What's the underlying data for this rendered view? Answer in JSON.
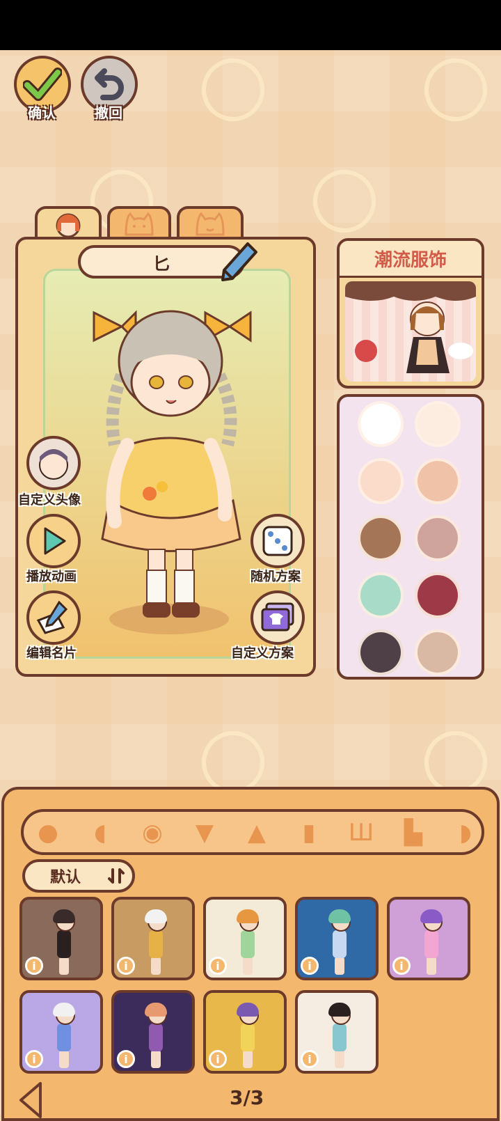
{
  "top_buttons": {
    "confirm_label": "确认",
    "undo_label": "撤回"
  },
  "tabs": [
    {
      "name": "face",
      "icon": "girl-face-icon"
    },
    {
      "name": "pet-cat",
      "icon": "cat-face-icon"
    },
    {
      "name": "pet-cat-2",
      "icon": "cat-smile-icon"
    }
  ],
  "character": {
    "name": "匕",
    "edit_icon": "pencil-icon"
  },
  "side_actions": {
    "custom_avatar": "自定义头像",
    "play_animation": "播放动画",
    "edit_card": "编辑名片",
    "random_plan": "随机方案",
    "custom_plan": "自定义方案"
  },
  "trend": {
    "title": "潮流服饰"
  },
  "palette": {
    "swatches": [
      "#ffffff",
      "#fdece0",
      "#fbdccb",
      "#f0c2a8",
      "#a57558",
      "#cfa49c",
      "#a8dcc8",
      "#9e3a48",
      "#4f3f46",
      "#d9b8a4"
    ]
  },
  "colors": {
    "outline": "#6b3a2a",
    "panel": "#f6d79b",
    "bottom_panel": "#f3b76d",
    "accent_red": "#d15c4a"
  },
  "categories": [
    {
      "name": "head",
      "icon": "head-icon"
    },
    {
      "name": "hair",
      "icon": "hair-icon"
    },
    {
      "name": "eye",
      "icon": "eye-icon"
    },
    {
      "name": "top",
      "icon": "shirt-icon"
    },
    {
      "name": "skirt",
      "icon": "skirt-icon"
    },
    {
      "name": "dress",
      "icon": "dress-icon"
    },
    {
      "name": "pants",
      "icon": "pants-icon"
    },
    {
      "name": "shoes",
      "icon": "shoe-icon"
    },
    {
      "name": "accessory",
      "icon": "accessory-icon"
    }
  ],
  "sort": {
    "label": "默认",
    "icon": "sort-icon"
  },
  "outfits": [
    {
      "bg": "#8a6a5a",
      "hair": "#3a2b2b",
      "body": "#2b2020"
    },
    {
      "bg": "#c79b62",
      "hair": "#f2f2f2",
      "body": "#e6b247"
    },
    {
      "bg": "#f3ead8",
      "hair": "#e7973f",
      "body": "#9fd49a"
    },
    {
      "bg": "#2f6aa7",
      "hair": "#6fc2a3",
      "body": "#c7d9f2"
    },
    {
      "bg": "#cf9fd8",
      "hair": "#8a5bc7",
      "body": "#f2a6d1"
    },
    {
      "bg": "#b9a7e6",
      "hair": "#f1f1f1",
      "body": "#6f8fe0"
    },
    {
      "bg": "#3b2c5c",
      "hair": "#e79a6f",
      "body": "#8f5ab0"
    },
    {
      "bg": "#e9b84a",
      "hair": "#7a5ab0",
      "body": "#f2d35a"
    },
    {
      "bg": "#f5ece2",
      "hair": "#2a2020",
      "body": "#88c7d0"
    }
  ],
  "pager": {
    "text": "3/3",
    "prev_icon": "arrow-left-icon"
  }
}
